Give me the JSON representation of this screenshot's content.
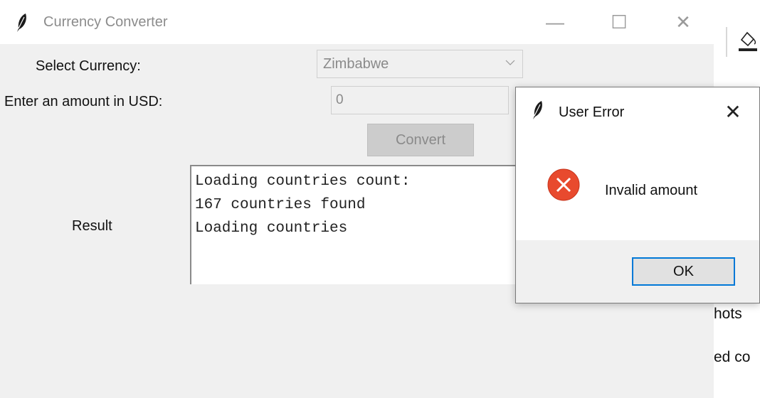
{
  "window": {
    "title": "Currency Converter",
    "min_glyph": "—",
    "max_glyph": "☐",
    "close_glyph": "✕"
  },
  "form": {
    "currency_label": "Select Currency:",
    "currency_value": "Zimbabwe",
    "amount_label": "Enter an amount in USD:",
    "amount_value": "0",
    "convert_label": "Convert",
    "result_label": "Result",
    "result_lines": [
      "Loading countries count:",
      "167 countries found",
      "Loading countries"
    ]
  },
  "dialog": {
    "title": "User Error",
    "close_glyph": "✕",
    "message": "Invalid amount",
    "ok_label": "OK",
    "icon": "error-icon"
  },
  "background_app": {
    "text_lines": [
      "hots",
      "ed co"
    ],
    "icon": "paint-bucket-icon"
  },
  "colors": {
    "dialog_ok_border": "#0078d7",
    "error_icon": "#e84a2e"
  }
}
